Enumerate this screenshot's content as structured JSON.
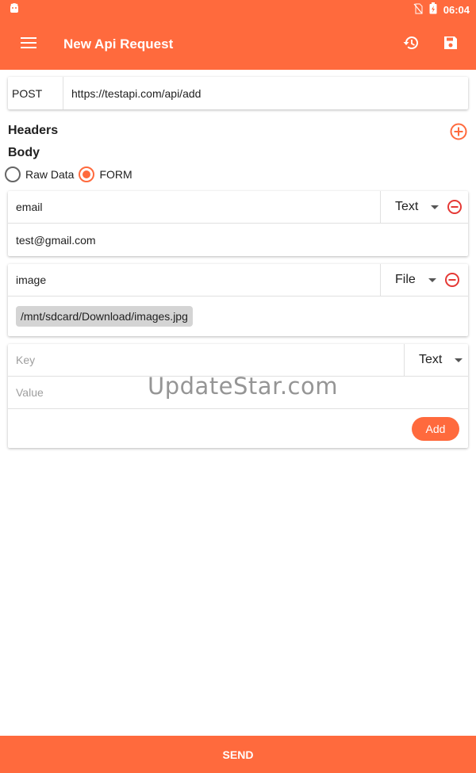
{
  "status_bar": {
    "time": "06:04"
  },
  "app_bar": {
    "title": "New Api Request"
  },
  "request": {
    "method": "POST",
    "url": "https://testapi.com/api/add"
  },
  "sections": {
    "headers": "Headers",
    "body": "Body"
  },
  "body_type": {
    "options": [
      "Raw Data",
      "FORM"
    ],
    "selected": "FORM"
  },
  "form_fields": [
    {
      "key": "email",
      "type": "Text",
      "value": "test@gmail.com"
    },
    {
      "key": "image",
      "type": "File",
      "value": "/mnt/sdcard/Download/images.jpg"
    }
  ],
  "new_field": {
    "key_placeholder": "Key",
    "value_placeholder": "Value",
    "type": "Text",
    "add_label": "Add"
  },
  "watermark": "UpdateStar.com",
  "send_label": "SEND",
  "colors": {
    "accent": "#ff6a3d"
  },
  "icons": [
    "android-icon",
    "no-sim-icon",
    "battery-charging-icon",
    "menu-icon",
    "history-icon",
    "save-icon",
    "add-circle-icon",
    "remove-circle-icon",
    "dropdown-caret-icon"
  ]
}
